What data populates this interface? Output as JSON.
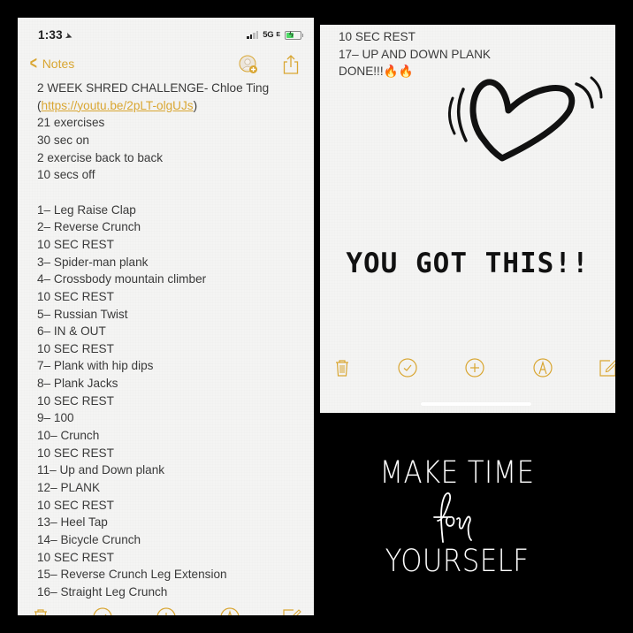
{
  "left_screen": {
    "status_bar": {
      "time": "1:33",
      "location_icon": "location-arrow-icon",
      "signal_bars_filled": 2,
      "signal_bars_total": 4,
      "network": "5G",
      "network_suffix": "E",
      "battery_charging": true,
      "battery_color": "#4cd964"
    },
    "nav": {
      "back_label": "Notes",
      "back_icon": "chevron-left-icon",
      "share_person_icon": "add-person-icon",
      "share_icon": "share-icon"
    },
    "note": {
      "title_line": "2 WEEK SHRED CHALLENGE- Chloe Ting",
      "link_open": "(",
      "link_text": "https://youtu.be/2pLT-olgUJs",
      "link_close": ")",
      "intro_lines": [
        "21 exercises",
        "30 sec on",
        "2 exercise back to back",
        "10 secs off",
        ""
      ],
      "exercise_lines": [
        "1– Leg Raise Clap",
        "2– Reverse Crunch",
        "10 SEC REST",
        "3– Spider-man plank",
        "4– Crossbody mountain climber",
        "10 SEC REST",
        "5– Russian Twist",
        "6– IN & OUT",
        "10 SEC REST",
        "7– Plank with hip dips",
        "8– Plank Jacks",
        "10 SEC REST",
        "9– 100",
        "10– Crunch",
        "10 SEC REST",
        "11– Up and Down plank",
        "12– PLANK",
        "10 SEC REST",
        "13– Heel Tap",
        "14– Bicycle Crunch",
        "10 SEC REST",
        "15– Reverse Crunch Leg Extension",
        "16– Straight Leg Crunch"
      ]
    },
    "toolbar": [
      "trash-icon",
      "checklist-icon",
      "add-icon",
      "markup-icon",
      "compose-icon"
    ]
  },
  "right_screen": {
    "note": {
      "lines": [
        "10 SEC REST",
        "17– UP AND DOWN PLANK"
      ],
      "done_line": "DONE!!!",
      "emoji": "🔥🔥"
    },
    "drawing": "heart-drawing",
    "big_text": "YOU GOT THIS!!",
    "toolbar": [
      "trash-icon",
      "checklist-icon",
      "add-icon",
      "markup-icon",
      "compose-icon"
    ]
  },
  "quote": {
    "line1": "MAKE TIME",
    "line2": "for",
    "line3": "YOURSELF"
  },
  "colors": {
    "accent": "#d9a632",
    "note_text": "#3a3a3a",
    "note_bg": "#f4f4f3",
    "page_bg": "#000000"
  }
}
